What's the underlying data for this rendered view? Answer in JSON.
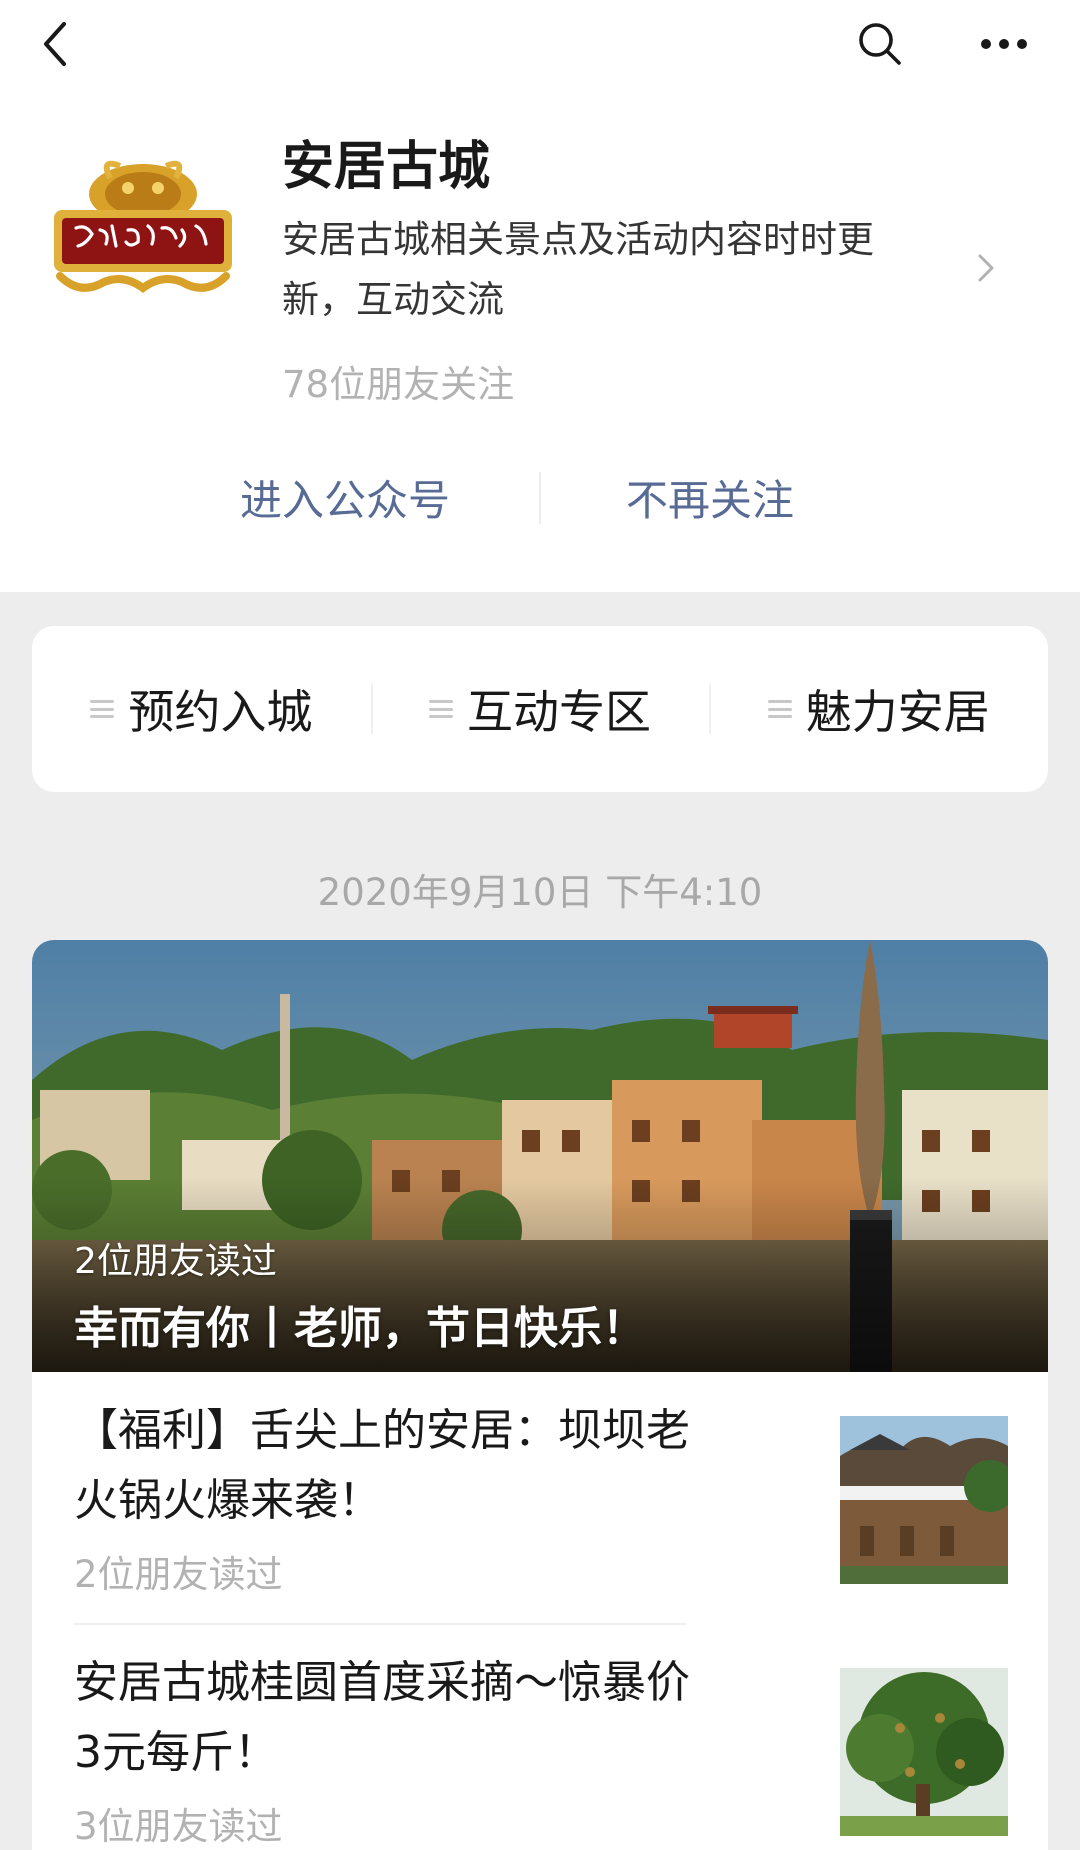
{
  "account": {
    "name": "安居古城",
    "description": "安居古城相关景点及活动内容时时更新，互动交流",
    "followers": "78位朋友关注",
    "logo_icon": "dragon-emblem-logo"
  },
  "actions": {
    "enter": "进入公众号",
    "unfollow": "不再关注"
  },
  "menu": {
    "items": [
      {
        "label": "预约入城"
      },
      {
        "label": "互动专区"
      },
      {
        "label": "魅力安居"
      }
    ]
  },
  "feed": {
    "timestamp": "2020年9月10日 下午4:10",
    "cover": {
      "readers": "2位朋友读过",
      "title": "幸而有你丨老师，节日快乐！"
    },
    "articles": [
      {
        "title": "【福利】舌尖上的安居：坝坝老火锅火爆来袭！",
        "readers": "2位朋友读过"
      },
      {
        "title": "安居古城桂圆首度采摘～惊暴价3元每斤！",
        "readers": "3位朋友读过"
      }
    ]
  },
  "icons": {
    "back": "back-arrow-icon",
    "search": "search-icon",
    "more": "more-dots-icon",
    "chevron": "chevron-right-icon",
    "menu": "menu-lines-icon"
  },
  "colors": {
    "link": "#576b95",
    "background": "#ededed",
    "text": "#191919",
    "secondary_text": "#b2b2b2"
  }
}
